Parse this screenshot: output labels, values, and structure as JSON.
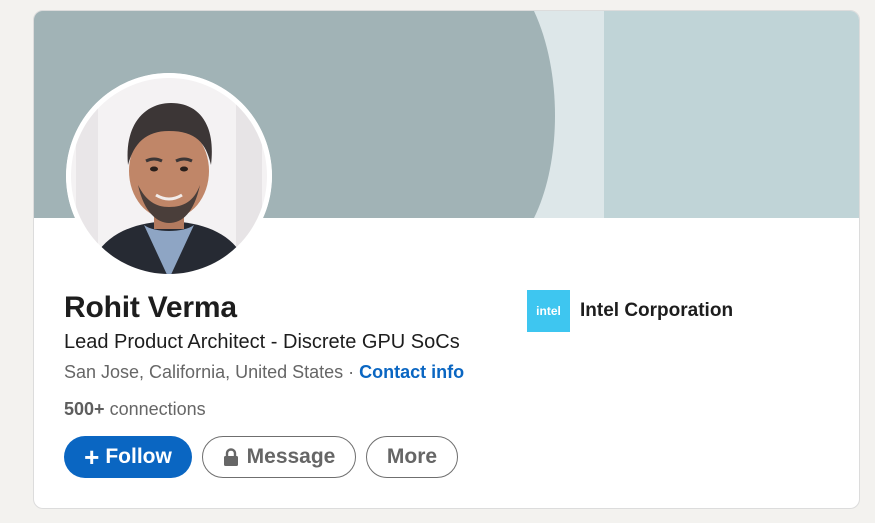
{
  "profile": {
    "name": "Rohit Verma",
    "headline": "Lead Product Architect - Discrete GPU SoCs",
    "location": "San Jose, California, United States",
    "separator": "·",
    "contact_label": "Contact info",
    "connections_count": "500+",
    "connections_label": "connections"
  },
  "company": {
    "logo_text": "intel",
    "name": "Intel Corporation"
  },
  "actions": {
    "follow_icon": "+",
    "follow_label": "Follow",
    "message_label": "Message",
    "more_label": "More"
  },
  "icons": {
    "follow": "plus-icon",
    "message": "lock-icon"
  },
  "colors": {
    "primary": "#0a66c2",
    "banner_dark": "#a1b3b6",
    "banner_light": "#dde7e9",
    "banner_right": "#c0d4d7",
    "intel_blue": "#3ec6f0"
  }
}
